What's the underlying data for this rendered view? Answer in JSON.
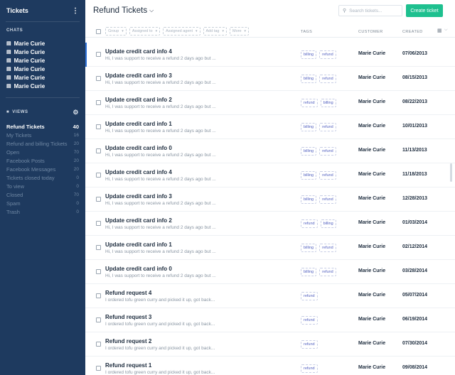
{
  "sidebar": {
    "title": "Tickets",
    "menu_icon": "kebab-icon",
    "chats_heading": "CHATS",
    "chat_icon": "chat-bubble-icon",
    "chats": [
      {
        "name": "Marie Curie"
      },
      {
        "name": "Marie Curie"
      },
      {
        "name": "Marie Curie"
      },
      {
        "name": "Marie Curie"
      },
      {
        "name": "Marie Curie"
      },
      {
        "name": "Marie Curie"
      }
    ],
    "views_heading": "VIEWS",
    "views_icon": "layers-icon",
    "settings_icon": "gear-icon",
    "views": [
      {
        "label": "Refund Tickets",
        "count": "40"
      },
      {
        "label": "My Tickets",
        "count": "16"
      },
      {
        "label": "Refund and billing Tickets",
        "count": "20"
      },
      {
        "label": "Open",
        "count": "70"
      },
      {
        "label": "Facebook Posts",
        "count": "20"
      },
      {
        "label": "Facebook Messages",
        "count": "20"
      },
      {
        "label": "Tickets closed today",
        "count": "0"
      },
      {
        "label": "To view",
        "count": "0"
      },
      {
        "label": "Closed",
        "count": "70"
      },
      {
        "label": "Spam",
        "count": "0"
      },
      {
        "label": "Trash",
        "count": "0"
      }
    ]
  },
  "header": {
    "title": "Refund Tickets",
    "title_icon": "chevron-down-icon",
    "search_placeholder": "Search tickets...",
    "search_icon": "search-icon",
    "create_label": "Create ticket"
  },
  "table": {
    "filters": [
      {
        "label": "Group"
      },
      {
        "label": "Assigned to"
      },
      {
        "label": "Assigned agent"
      },
      {
        "label": "Add tag"
      },
      {
        "label": "More"
      }
    ],
    "columns": {
      "tags": "TAGS",
      "customer": "CUSTOMER",
      "created": "CREATED"
    },
    "columns_icon": "columns-icon",
    "rows": [
      {
        "title": "Update credit card info 4",
        "preview": "Hi, I was support to receive a refund 2 days ago but ...",
        "tags": [
          "billing",
          "refund"
        ],
        "customer": "Marie Curie",
        "created": "07/06/2013"
      },
      {
        "title": "Update credit card info 3",
        "preview": "Hi, I was support to receive a refund 2 days ago but ...",
        "tags": [
          "billing",
          "refund"
        ],
        "customer": "Marie Curie",
        "created": "08/15/2013"
      },
      {
        "title": "Update credit card info 2",
        "preview": "Hi, I was support to receive a refund 2 days ago but ...",
        "tags": [
          "refund",
          "billing"
        ],
        "customer": "Marie Curie",
        "created": "08/22/2013"
      },
      {
        "title": "Update credit card info 1",
        "preview": "Hi, I was support to receive a refund 2 days ago but ...",
        "tags": [
          "billing",
          "refund"
        ],
        "customer": "Marie Curie",
        "created": "10/01/2013"
      },
      {
        "title": "Update credit card info 0",
        "preview": "Hi, I was support to receive a refund 2 days ago but ...",
        "tags": [
          "billing",
          "refund"
        ],
        "customer": "Marie Curie",
        "created": "11/13/2013"
      },
      {
        "title": "Update credit card info 4",
        "preview": "Hi, I was support to receive a refund 2 days ago but ...",
        "tags": [
          "billing",
          "refund"
        ],
        "customer": "Marie Curie",
        "created": "11/18/2013"
      },
      {
        "title": "Update credit card info 3",
        "preview": "Hi, I was support to receive a refund 2 days ago but ...",
        "tags": [
          "billing",
          "refund"
        ],
        "customer": "Marie Curie",
        "created": "12/28/2013"
      },
      {
        "title": "Update credit card info 2",
        "preview": "Hi, I was support to receive a refund 2 days ago but ...",
        "tags": [
          "refund",
          "billing"
        ],
        "customer": "Marie Curie",
        "created": "01/03/2014"
      },
      {
        "title": "Update credit card info 1",
        "preview": "Hi, I was support to receive a refund 2 days ago but ...",
        "tags": [
          "billing",
          "refund"
        ],
        "customer": "Marie Curie",
        "created": "02/12/2014"
      },
      {
        "title": "Update credit card info 0",
        "preview": "Hi, I was support to receive a refund 2 days ago but ...",
        "tags": [
          "billing",
          "refund"
        ],
        "customer": "Marie Curie",
        "created": "03/28/2014"
      },
      {
        "title": "Refund request 4",
        "preview": "I ordered tofu green curry and picked it up, got back...",
        "tags": [
          "refund"
        ],
        "customer": "Marie Curie",
        "created": "05/07/2014"
      },
      {
        "title": "Refund request 3",
        "preview": "I ordered tofu green curry and picked it up, got back...",
        "tags": [
          "refund"
        ],
        "customer": "Marie Curie",
        "created": "06/19/2014"
      },
      {
        "title": "Refund request 2",
        "preview": "I ordered tofu green curry and picked it up, got back...",
        "tags": [
          "refund"
        ],
        "customer": "Marie Curie",
        "created": "07/30/2014"
      },
      {
        "title": "Refund request 1",
        "preview": "I ordered tofu green curry and picked it up, got back...",
        "tags": [
          "refund"
        ],
        "customer": "Marie Curie",
        "created": "09/08/2014"
      }
    ]
  },
  "colors": {
    "sidebar_bg": "#1e3a5f",
    "accent": "#1ec08f",
    "selected_marker": "#2b6fd6",
    "tag_text": "#5563c1"
  }
}
